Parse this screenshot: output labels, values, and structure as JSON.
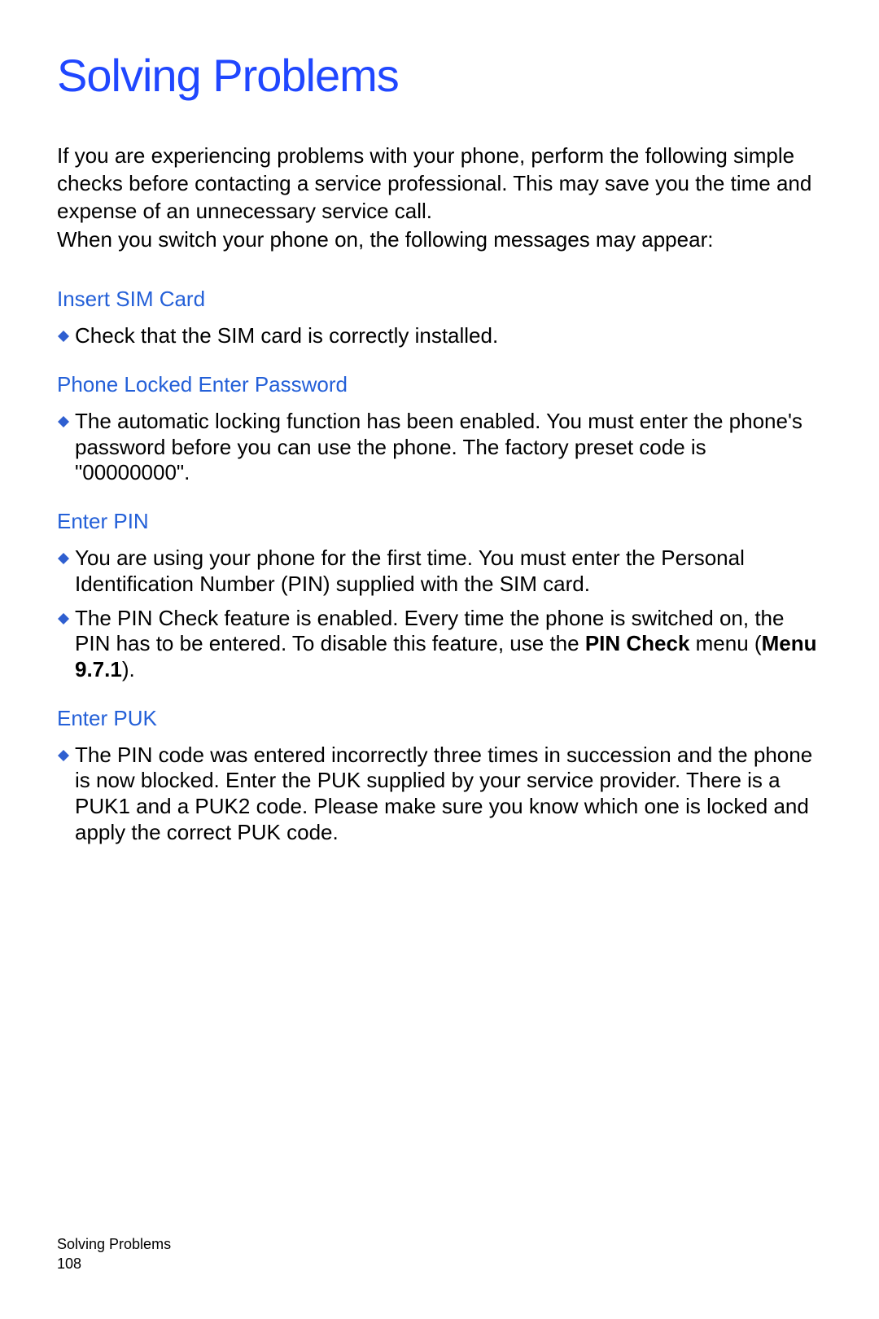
{
  "title": "Solving Problems",
  "intro1": "If you are experiencing problems with your phone, perform the following simple checks before contacting a service professional. This may save you the time and expense of an unnecessary service call.",
  "intro2": "When you switch your phone on, the following messages may appear:",
  "s1_head": "Insert SIM Card",
  "s1_b1": "Check that the SIM card is correctly installed.",
  "s2_head": "Phone Locked Enter Password",
  "s2_b1": "The automatic locking function has been enabled. You must enter the phone's password before you can use the phone. The factory preset code is \"00000000\".",
  "s3_head": "Enter PIN",
  "s3_b1": "You are using your phone for the first time. You must enter the Personal Identification Number (PIN) supplied with the SIM card.",
  "s3_b2_part1": "The PIN Check feature is enabled. Every time the phone is switched on, the PIN has to be entered. To disable this feature, use the ",
  "s3_b2_bold1": "PIN Check",
  "s3_b2_part2": " menu (",
  "s3_b2_bold2": "Menu 9.7.1",
  "s3_b2_part3": ").",
  "s4_head": "Enter PUK",
  "s4_b1": "The PIN code was entered incorrectly three times in succession and the phone is now blocked. Enter the PUK supplied by your service provider. There is a PUK1 and a PUK2 code. Please make sure you know which one is locked and apply the correct PUK code.",
  "footer_title": "Solving Problems",
  "footer_page": "108"
}
